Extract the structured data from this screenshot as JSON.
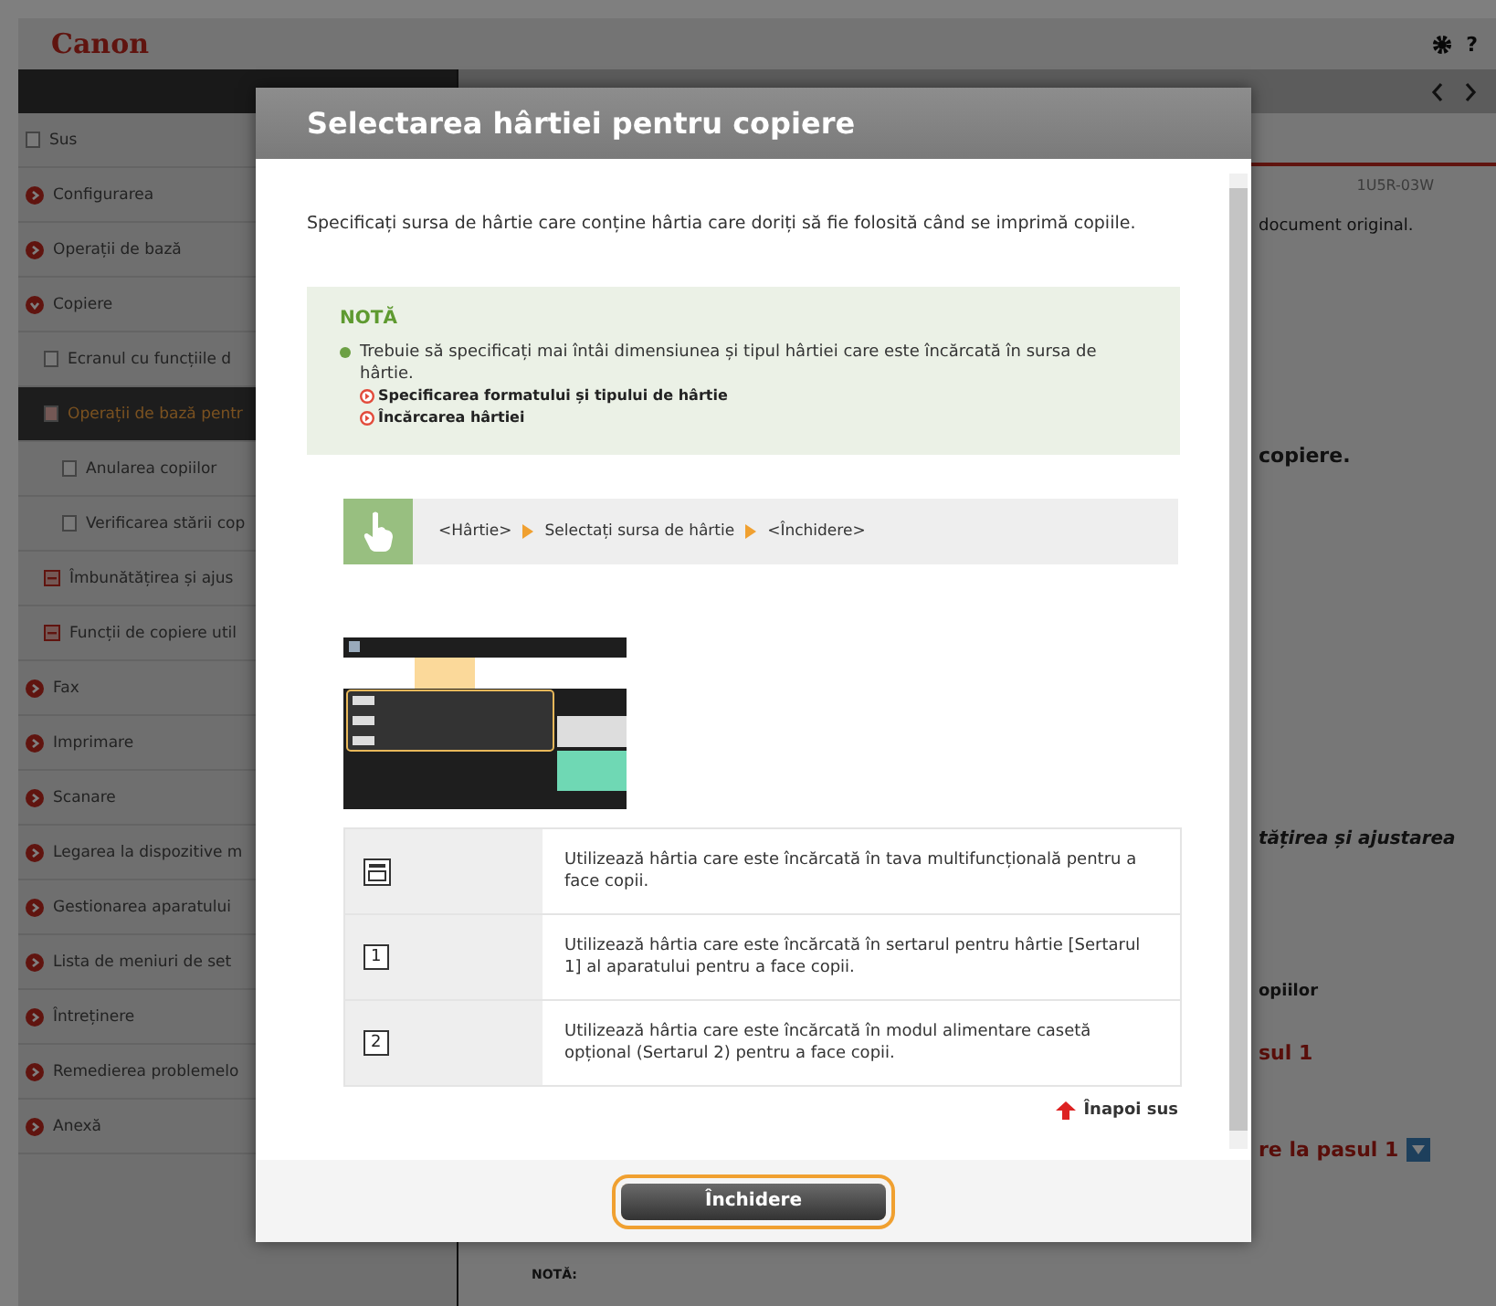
{
  "header": {
    "logo": "Canon",
    "help": "?"
  },
  "sidebar": {
    "items": [
      {
        "kind": "page",
        "label": "Sus",
        "selected": false
      },
      {
        "kind": "section",
        "label": "Configurarea",
        "expanded": false,
        "selected": false
      },
      {
        "kind": "section",
        "label": "Operații de bază",
        "expanded": false,
        "selected": false
      },
      {
        "kind": "section",
        "label": "Copiere",
        "expanded": true,
        "selected": false,
        "children": [
          {
            "kind": "page",
            "label": "Ecranul cu funcțiile d",
            "selected": false
          },
          {
            "kind": "page",
            "label": "Operații de bază pentr",
            "selected": true,
            "children": [
              {
                "kind": "page",
                "label": "Anularea copiilor",
                "selected": false
              },
              {
                "kind": "page",
                "label": "Verificarea stării cop",
                "selected": false
              }
            ]
          },
          {
            "kind": "group",
            "label": "Îmbunătățirea și ajus",
            "selected": false
          },
          {
            "kind": "group",
            "label": "Funcții de copiere util",
            "selected": false
          }
        ]
      },
      {
        "kind": "section",
        "label": "Fax",
        "expanded": false,
        "selected": false
      },
      {
        "kind": "section",
        "label": "Imprimare",
        "expanded": false,
        "selected": false
      },
      {
        "kind": "section",
        "label": "Scanare",
        "expanded": false,
        "selected": false
      },
      {
        "kind": "section",
        "label": "Legarea la dispozitive m",
        "expanded": false,
        "selected": false
      },
      {
        "kind": "section",
        "label": "Gestionarea aparatului",
        "expanded": false,
        "selected": false
      },
      {
        "kind": "section",
        "label": "Lista de meniuri de set",
        "expanded": false,
        "selected": false
      },
      {
        "kind": "section",
        "label": "Întreținere",
        "expanded": false,
        "selected": false
      },
      {
        "kind": "section",
        "label": "Remedierea problemelo",
        "expanded": false,
        "selected": false
      },
      {
        "kind": "section",
        "label": "Anexă",
        "expanded": false,
        "selected": false
      }
    ]
  },
  "content": {
    "doc_id": "1U5R-03W",
    "fragments": [
      {
        "kind": "text",
        "text": "document original."
      },
      {
        "kind": "heading",
        "text": "copiere."
      },
      {
        "kind": "subheading",
        "text": "tățirea și ajustarea"
      },
      {
        "kind": "subheading",
        "text": "opiilor"
      },
      {
        "kind": "link",
        "text": "sul 1"
      },
      {
        "kind": "link-icon",
        "text": "re la pasul 1"
      },
      {
        "kind": "note",
        "text": "NOTĂ:"
      }
    ]
  },
  "dialog": {
    "title": "Selectarea hârtiei pentru copiere",
    "intro": "Specificați sursa de hârtie care conține hârtia care doriți să fie folosită când se imprimă copiile.",
    "note": {
      "title": "NOTĂ",
      "text": "Trebuie să specificați mai întâi dimensiunea și tipul hârtiei care este încărcată în sursa de hârtie.",
      "links": [
        "Specificarea formatului și tipului de hârtie",
        "Încărcarea hârtiei"
      ]
    },
    "steps": [
      "<Hârtie>",
      "Selectați sursa de hârtie",
      "<Închidere>"
    ],
    "table": {
      "rows": [
        {
          "kind": "tray",
          "text": "Utilizează hârtia care este încărcată în tava multifuncțională pentru a face copii."
        },
        {
          "kind": "number",
          "icon": "1",
          "text": "Utilizează hârtia care este încărcată în sertarul pentru hârtie [Sertarul 1] al aparatului pentru a face copii."
        },
        {
          "kind": "number",
          "icon": "2",
          "text": "Utilizează hârtia care este încărcată în modul alimentare casetă opțional (Sertarul 2) pentru a face copii."
        }
      ]
    },
    "back_to_top": "Înapoi sus",
    "close_button": {
      "label": "Închidere",
      "focused": true
    }
  }
}
